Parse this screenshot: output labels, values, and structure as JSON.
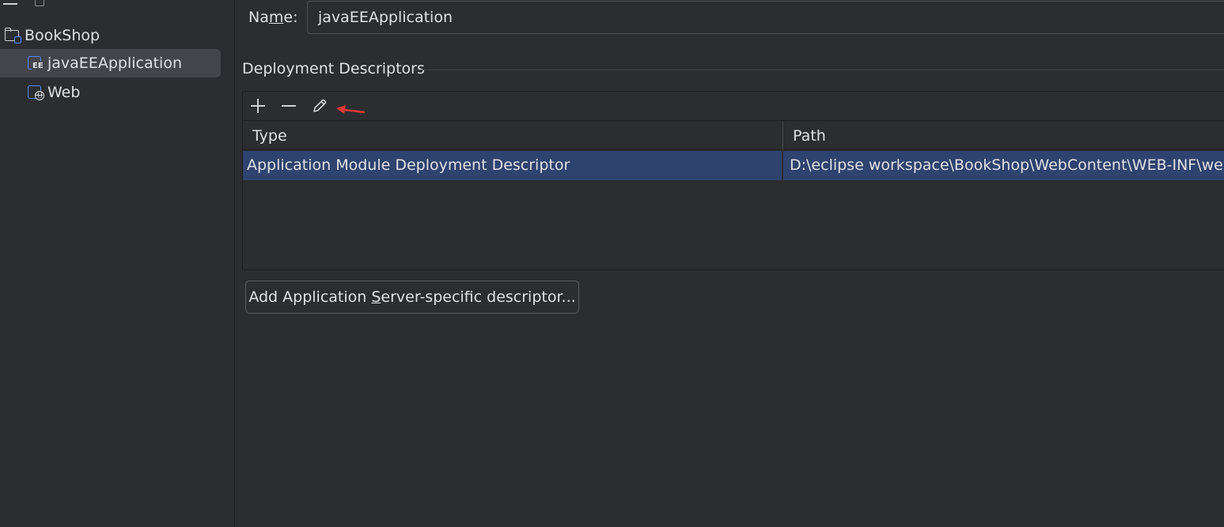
{
  "sidebar": {
    "items": [
      {
        "label": "BookShop",
        "icon": "folder-module-icon"
      },
      {
        "label": "javaEEApplication",
        "icon": "javaee-module-icon",
        "selected": true
      },
      {
        "label": "Web",
        "icon": "web-module-icon"
      }
    ]
  },
  "form": {
    "name_label_pre": "Na",
    "name_label_mnemonic": "m",
    "name_label_post": "e:",
    "name_value": "javaEEApplication"
  },
  "deployment": {
    "section_title": "Deployment Descriptors",
    "toolbar": {
      "add_icon": "plus-icon",
      "remove_icon": "minus-icon",
      "edit_icon": "pencil-icon",
      "annotation_color": "#e53935"
    },
    "columns": [
      "Type",
      "Path"
    ],
    "rows": [
      {
        "type": "Application Module Deployment Descriptor",
        "path": "D:\\eclipse workspace\\BookShop\\WebContent\\WEB-INF\\web.xml"
      }
    ],
    "add_button_pre": "Add Application ",
    "add_button_mnemonic": "S",
    "add_button_post": "erver-specific descriptor..."
  },
  "colors": {
    "background": "#2b2d30",
    "selection": "#2e436e",
    "sidebar_selection": "#43454a",
    "accent": "#548af7"
  }
}
